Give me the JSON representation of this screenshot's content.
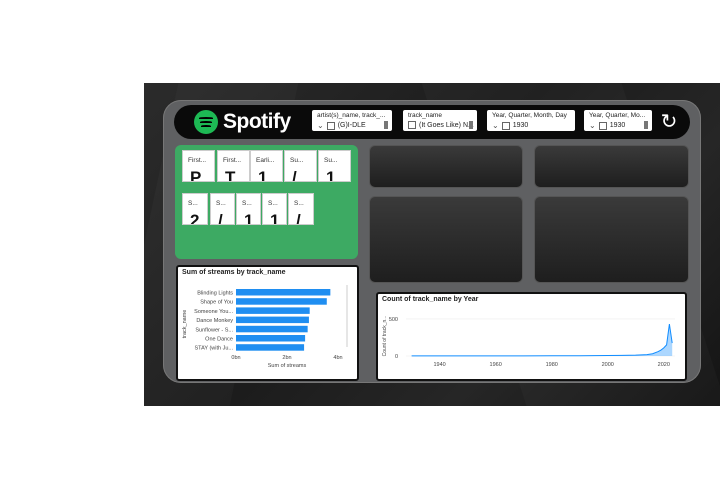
{
  "brand": {
    "name": "Spotify",
    "accent": "#1db954"
  },
  "slicers": [
    {
      "title": "artist(s)_name, track_...",
      "value": "(G)I-DLE"
    },
    {
      "title": "track_name",
      "value": "(It Goes Like) N..."
    },
    {
      "title": "Year, Quarter, Month, Day",
      "value": "1930"
    },
    {
      "title": "Year, Quarter, Mo...",
      "value": "1930"
    }
  ],
  "kpi_cards_row1": [
    {
      "label": "First...",
      "value": "P"
    },
    {
      "label": "First...",
      "value": "T"
    },
    {
      "label": "Earli...",
      "value": "1"
    },
    {
      "label": "Su...",
      "value": "/"
    },
    {
      "label": "Su...",
      "value": "1"
    }
  ],
  "kpi_cards_row2": [
    {
      "label": "S...",
      "value": "2"
    },
    {
      "label": "S...",
      "value": "/"
    },
    {
      "label": "S...",
      "value": "1"
    },
    {
      "label": "S...",
      "value": "1"
    },
    {
      "label": "S...",
      "value": "/"
    }
  ],
  "chart_data": [
    {
      "type": "bar",
      "title": "Sum of streams by track_name",
      "xlabel": "Sum of streams",
      "ylabel": "track_name",
      "categories": [
        "Blinding Lights",
        "Shape of You",
        "Someone You...",
        "Dance Monkey",
        "Sunflower - S...",
        "One Dance",
        "STAY (with Ju..."
      ],
      "values": [
        3.7,
        3.56,
        2.89,
        2.86,
        2.81,
        2.71,
        2.67
      ],
      "xlim": [
        0,
        4
      ],
      "xticks": [
        "0bn",
        "2bn",
        "4bn"
      ],
      "bar_color": "#1f8ef1"
    },
    {
      "type": "area",
      "title": "Count of track_name by Year",
      "ylabel": "Count of track_n...",
      "xticks": [
        "1940",
        "1960",
        "1980",
        "2000",
        "2020"
      ],
      "yticks": [
        "0",
        "500"
      ],
      "x": [
        1930,
        1940,
        1950,
        1960,
        1970,
        1980,
        1990,
        2000,
        2005,
        2010,
        2014,
        2016,
        2018,
        2019,
        2020,
        2021,
        2022,
        2023
      ],
      "values": [
        1,
        1,
        1,
        2,
        2,
        3,
        4,
        7,
        9,
        12,
        18,
        30,
        60,
        80,
        110,
        150,
        430,
        175
      ],
      "xlim": [
        1928,
        2024
      ],
      "ylim": [
        0,
        620
      ],
      "color": "#118dff"
    }
  ]
}
